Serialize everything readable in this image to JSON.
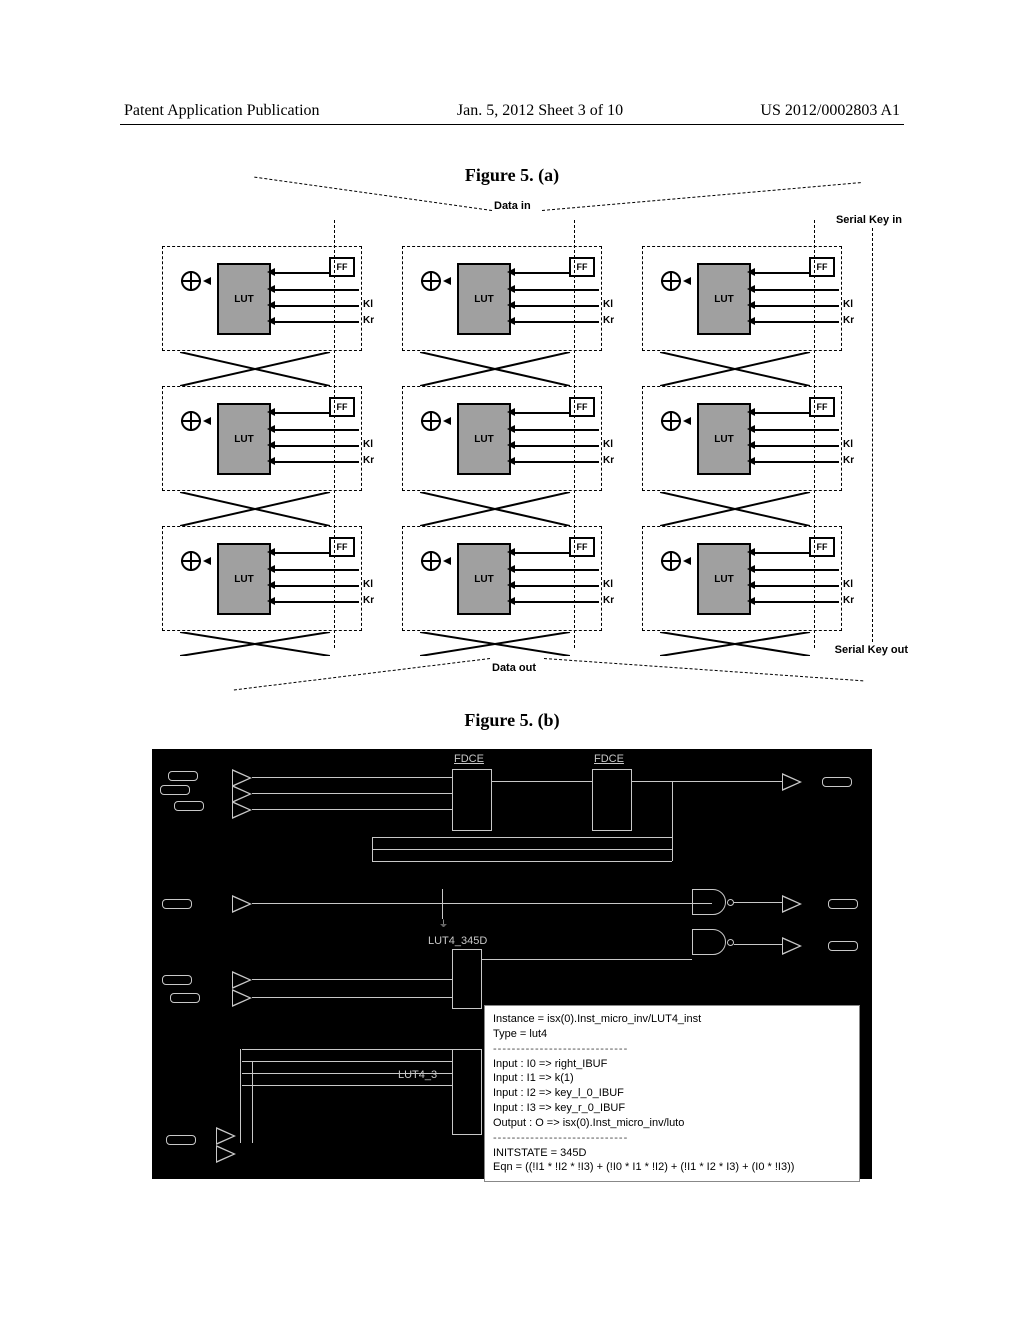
{
  "header": {
    "left": "Patent Application Publication",
    "center": "Jan. 5, 2012  Sheet 3 of 10",
    "right": "US 2012/0002803 A1"
  },
  "figures": {
    "a": {
      "title": "Figure 5. (a)"
    },
    "b": {
      "title": "Figure 5. (b)"
    }
  },
  "fig5a": {
    "data_in": "Data in",
    "data_out": "Data out",
    "serial_key_in": "Serial Key in",
    "serial_key_out": "Serial Key out",
    "lut": "LUT",
    "ff": "FF",
    "kl": "Kl",
    "kr": "Kr"
  },
  "fig5b": {
    "fdce1": "FDCE",
    "fdce2": "FDCE",
    "lut4_1": "LUT4_345D",
    "lut4_2": "LUT4_3",
    "tooltip": {
      "instance": "Instance = isx(0).Inst_micro_inv/LUT4_inst",
      "type": "Type = lut4",
      "dashes1": "-----------------------------",
      "in0": "Input : I0 => right_IBUF",
      "in1": "Input : I1 => k(1)",
      "in2": "Input : I2 => key_l_0_IBUF",
      "in3": "Input : I3 => key_r_0_IBUF",
      "out": "Output : O => isx(0).Inst_micro_inv/luto",
      "dashes2": "-----------------------------",
      "init": "INITSTATE = 345D",
      "eqn": "Eqn = ((!I1 * !I2 * !I3) + (!I0 * I1 * !I2) + (!I1 * I2 * I3) + (I0 * !I3))"
    }
  }
}
